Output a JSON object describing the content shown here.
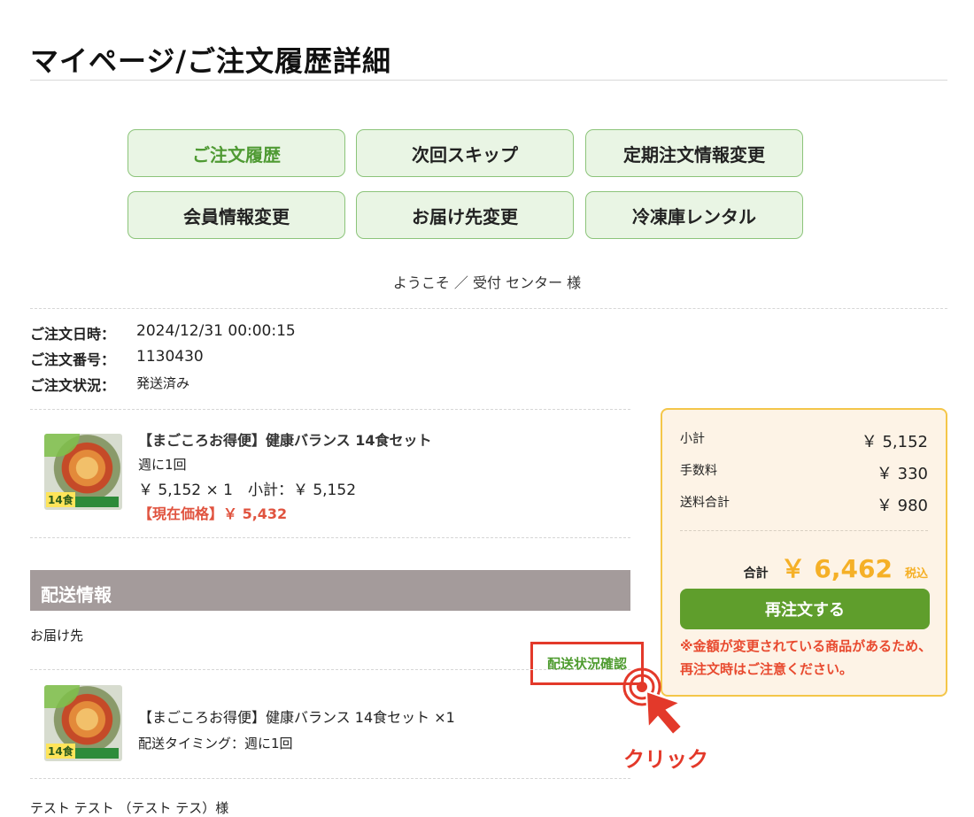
{
  "page": {
    "title": "マイページ/ご注文履歴詳細"
  },
  "nav": [
    {
      "label": "ご注文履歴"
    },
    {
      "label": "次回スキップ"
    },
    {
      "label": "定期注文情報変更"
    },
    {
      "label": "会員情報変更"
    },
    {
      "label": "お届け先変更"
    },
    {
      "label": "冷凍庫レンタル"
    }
  ],
  "welcome": "ようこそ ／ 受付 センター 様",
  "order": {
    "date_label": "ご注文日時：",
    "date": "2024/12/31 00:00:15",
    "number_label": "ご注文番号：",
    "number": "1130430",
    "status_label": "ご注文状況：",
    "status": "発送済み"
  },
  "item": {
    "name": "【まごころお得便】健康バランス 14食セット",
    "frequency": "週に1回",
    "price_line": "￥ 5,152 × 1　小計：￥ 5,152",
    "current_price": "【現在価格】￥ 5,432",
    "thumb_badge": "14食"
  },
  "summary": {
    "subtotal_label": "小計",
    "subtotal": "￥ 5,152",
    "fee_label": "手数料",
    "fee": "￥ 330",
    "shipping_label": "送料合計",
    "shipping": "￥ 980",
    "total_label": "合計",
    "total": "￥ 6,462",
    "tax_label": "税込",
    "reorder_button": "再注文する",
    "warning": "※金額が変更されている商品があるため、再注文時はご注意ください。"
  },
  "shipping": {
    "section_title": "配送情報",
    "destination_label": "お届け先",
    "track_link": "配送状況確認",
    "item_line": "【まごころお得便】健康バランス 14食セット ×1",
    "timing": "配送タイミング：週に1回",
    "recipient": "テスト テスト （テスト テス）様"
  },
  "annotation": {
    "click_label": "クリック"
  }
}
